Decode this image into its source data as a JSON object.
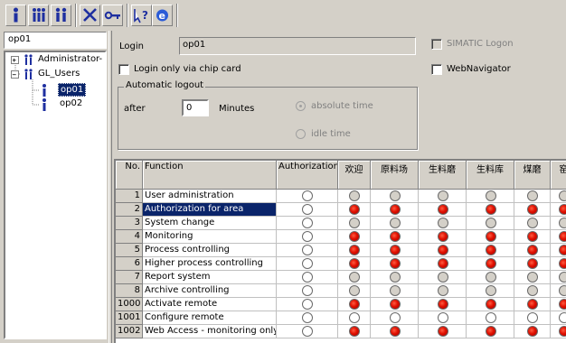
{
  "toolbar": {
    "buttons": [
      {
        "name": "user-icon",
        "color": "#1e2fa0"
      },
      {
        "name": "group-icon",
        "color": "#1e2fa0"
      },
      {
        "name": "users-icon",
        "color": "#1e2fa0"
      },
      {
        "name": "delete-icon",
        "color": "#1e2fa0"
      },
      {
        "name": "key-icon",
        "color": "#1e2fa0"
      },
      {
        "name": "help-icon",
        "color": "#1e2fa0"
      },
      {
        "name": "browser-icon",
        "color": "#1e2fa0"
      }
    ]
  },
  "left": {
    "current_user": "op01",
    "tree": {
      "items": [
        {
          "label": "Administrator-"
        },
        {
          "label": "GL_Users"
        },
        {
          "label": "op01"
        },
        {
          "label": "op02"
        }
      ]
    }
  },
  "form": {
    "login_label": "Login",
    "login_value": "op01",
    "simatic_logon": "SIMATIC Logon",
    "chip_card": "Login only via chip card",
    "webnavigator": "WebNavigator",
    "auto_logout": {
      "title": "Automatic logout",
      "after_label": "after",
      "minutes_value": "0",
      "minutes_label": "Minutes",
      "absolute_time": "absolute time",
      "idle_time": "idle time"
    }
  },
  "grid": {
    "headers": {
      "no": "No.",
      "function": "Function",
      "authorization": "Authorization",
      "areas": [
        "欢迎",
        "原料场",
        "生料磨",
        "生料库",
        "煤磨",
        "窑"
      ]
    },
    "rows": [
      {
        "no": "1",
        "function": "User administration",
        "auth": "white",
        "areas": [
          "gray",
          "gray",
          "gray",
          "gray",
          "gray",
          "gray"
        ]
      },
      {
        "no": "2",
        "function": "Authorization for area",
        "auth": "white",
        "areas": [
          "red",
          "red",
          "red",
          "red",
          "red",
          "red"
        ],
        "selected": true
      },
      {
        "no": "3",
        "function": "System change",
        "auth": "white",
        "areas": [
          "gray",
          "gray",
          "gray",
          "gray",
          "gray",
          "gray"
        ]
      },
      {
        "no": "4",
        "function": "Monitoring",
        "auth": "white",
        "areas": [
          "red",
          "red",
          "red",
          "red",
          "red",
          "red"
        ]
      },
      {
        "no": "5",
        "function": "Process controlling",
        "auth": "white",
        "areas": [
          "red",
          "red",
          "red",
          "red",
          "red",
          "red"
        ]
      },
      {
        "no": "6",
        "function": "Higher process controlling",
        "auth": "white",
        "areas": [
          "red",
          "red",
          "red",
          "red",
          "red",
          "red"
        ]
      },
      {
        "no": "7",
        "function": "Report system",
        "auth": "white",
        "areas": [
          "gray",
          "gray",
          "gray",
          "gray",
          "gray",
          "gray"
        ]
      },
      {
        "no": "8",
        "function": "Archive controlling",
        "auth": "white",
        "areas": [
          "gray",
          "gray",
          "gray",
          "gray",
          "gray",
          "gray"
        ]
      },
      {
        "no": "1000",
        "function": "Activate remote",
        "auth": "white",
        "areas": [
          "red",
          "red",
          "red",
          "red",
          "red",
          "red"
        ]
      },
      {
        "no": "1001",
        "function": "Configure remote",
        "auth": "white",
        "areas": [
          "white",
          "white",
          "white",
          "white",
          "white",
          "white"
        ]
      },
      {
        "no": "1002",
        "function": "Web Access - monitoring only",
        "auth": "white",
        "areas": [
          "red",
          "red",
          "red",
          "red",
          "red",
          "red"
        ]
      }
    ]
  }
}
